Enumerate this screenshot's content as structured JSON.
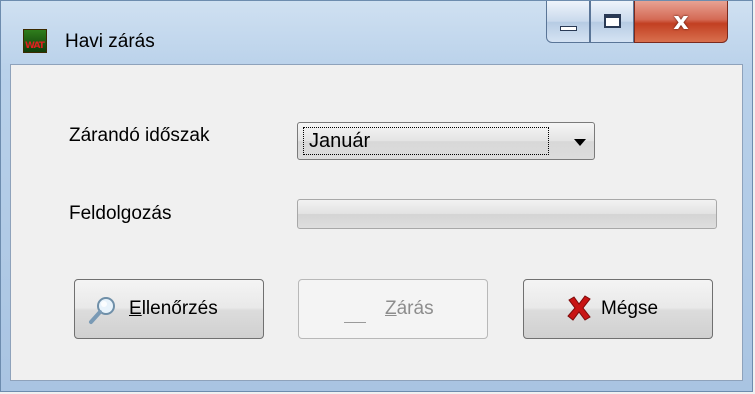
{
  "window": {
    "title": "Havi zárás",
    "app_icon_text": "WAT",
    "close_glyph": "x"
  },
  "form": {
    "period_label": "Zárandó időszak",
    "period_selected": "Január",
    "progress_label": "Feldolgozás",
    "progress_value": 0
  },
  "buttons": {
    "check_mnemonic": "E",
    "check_rest": "llenőrzés",
    "close_mnemonic": "Z",
    "close_rest": "árás",
    "cancel_label": "Mégse"
  },
  "icons": {
    "check": "magnifier-icon",
    "close": "close-month-icon",
    "cancel": "red-x-icon"
  },
  "colors": {
    "cancel_x": "#c81414",
    "title_close": "#c23f22"
  }
}
